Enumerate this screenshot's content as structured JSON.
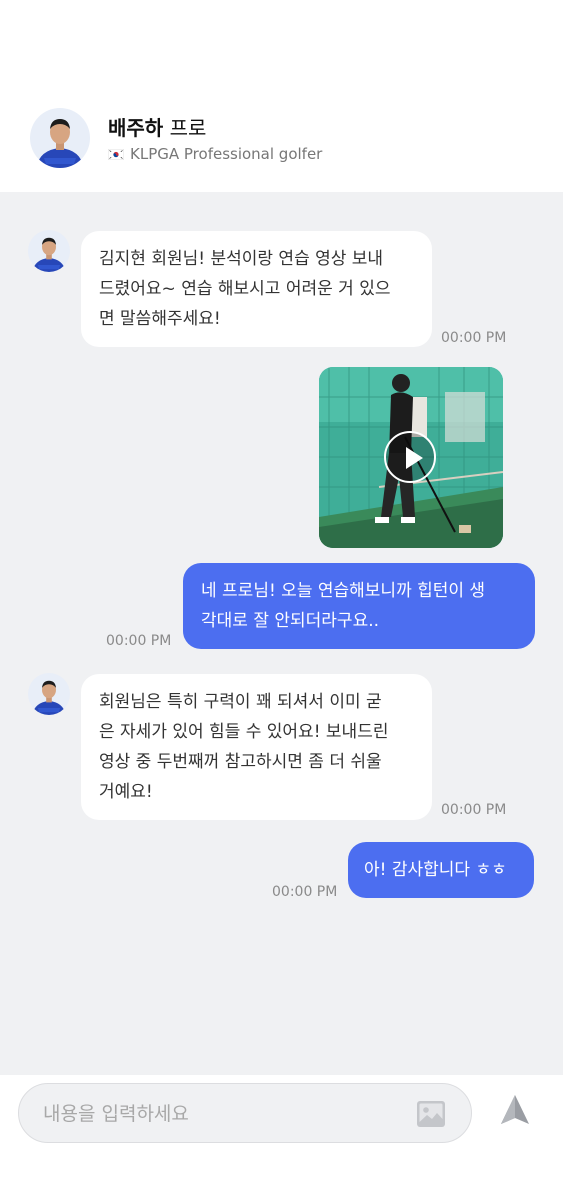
{
  "header": {
    "name": "배주하",
    "role": "프로",
    "subtitle": "KLPGA Professional golfer"
  },
  "messages": [
    {
      "sender": "pro",
      "lines": [
        "김지현 회원님! 분석이랑 연습 영상 보내",
        "드렸어요~ 연습 해보시고 어려운 거 있으",
        "면 말씀해주세요!"
      ],
      "time": "00:00 PM"
    },
    {
      "sender": "pro",
      "type": "video"
    },
    {
      "sender": "me",
      "lines": [
        "네 프로님! 오늘 연습해보니까 힙턴이 생",
        "각대로 잘 안되더라구요.."
      ],
      "time": "00:00 PM"
    },
    {
      "sender": "pro",
      "lines": [
        "회원님은 특히 구력이 꽤 되셔서 이미 굳",
        "은 자세가 있어 힘들 수 있어요! 보내드린",
        "영상 중 두번째꺼 참고하시면 좀 더 쉬울",
        "거예요!"
      ],
      "time": "00:00 PM"
    },
    {
      "sender": "me",
      "lines": [
        "아! 감사합니다 ㅎㅎ"
      ],
      "time": "00:00 PM"
    }
  ],
  "composer": {
    "placeholder": "내용을 입력하세요"
  },
  "colors": {
    "accent": "#4c6ef0",
    "chat_bg": "#f0f1f3",
    "incoming_bubble": "#ffffff"
  },
  "icons": [
    "image-icon",
    "send-icon",
    "play-icon",
    "korea-flag-icon"
  ]
}
